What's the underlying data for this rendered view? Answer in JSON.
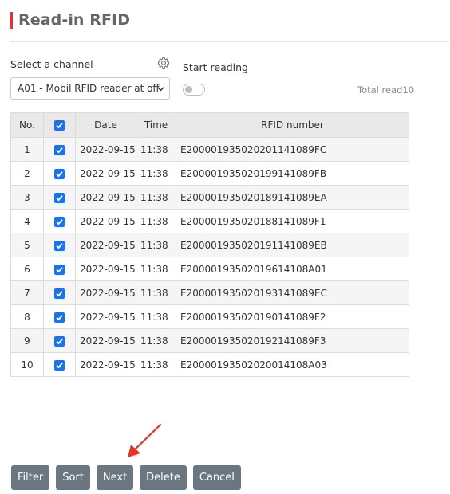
{
  "page": {
    "title": "Read-in RFID",
    "accent_color": "#d9363e"
  },
  "channel": {
    "label": "Select a channel",
    "selected": "A01 - Mobil RFID reader at off",
    "settings_icon": "gear-icon"
  },
  "reading": {
    "start_label": "Start reading",
    "toggle_on": false,
    "total_text": "Total read10"
  },
  "table": {
    "headers": {
      "no": "No.",
      "date": "Date",
      "time": "Time",
      "rfid": "RFID number"
    },
    "header_checked": true,
    "rows": [
      {
        "no": "1",
        "checked": true,
        "date": "2022-09-15",
        "time": "11:38",
        "rfid": "E200001935020201141089FC"
      },
      {
        "no": "2",
        "checked": true,
        "date": "2022-09-15",
        "time": "11:38",
        "rfid": "E20000193502019914108 9FB"
      },
      {
        "no": "3",
        "checked": true,
        "date": "2022-09-15",
        "time": "11:38",
        "rfid": "E200001935020189141089EA"
      },
      {
        "no": "4",
        "checked": true,
        "date": "2022-09-15",
        "time": "11:38",
        "rfid": "E200001935020188141089F1"
      },
      {
        "no": "5",
        "checked": true,
        "date": "2022-09-15",
        "time": "11:38",
        "rfid": "E200001935020191141089EB"
      },
      {
        "no": "6",
        "checked": true,
        "date": "2022-09-15",
        "time": "11:38",
        "rfid": "E20000193502019614108A01"
      },
      {
        "no": "7",
        "checked": true,
        "date": "2022-09-15",
        "time": "11:38",
        "rfid": "E200001935020193141089EC"
      },
      {
        "no": "8",
        "checked": true,
        "date": "2022-09-15",
        "time": "11:38",
        "rfid": "E200001935020190141089F2"
      },
      {
        "no": "9",
        "checked": true,
        "date": "2022-09-15",
        "time": "11:38",
        "rfid": "E200001935020192141089F3"
      },
      {
        "no": "10",
        "checked": true,
        "date": "2022-09-15",
        "time": "11:38",
        "rfid": "E20000193502020014108A03"
      }
    ]
  },
  "buttons": {
    "filter": "Filter",
    "sort": "Sort",
    "next": "Next",
    "delete": "Delete",
    "cancel": "Cancel",
    "color": "#6b7780"
  },
  "annotation": {
    "arrow_color": "#e8332a",
    "points_to": "Next"
  }
}
